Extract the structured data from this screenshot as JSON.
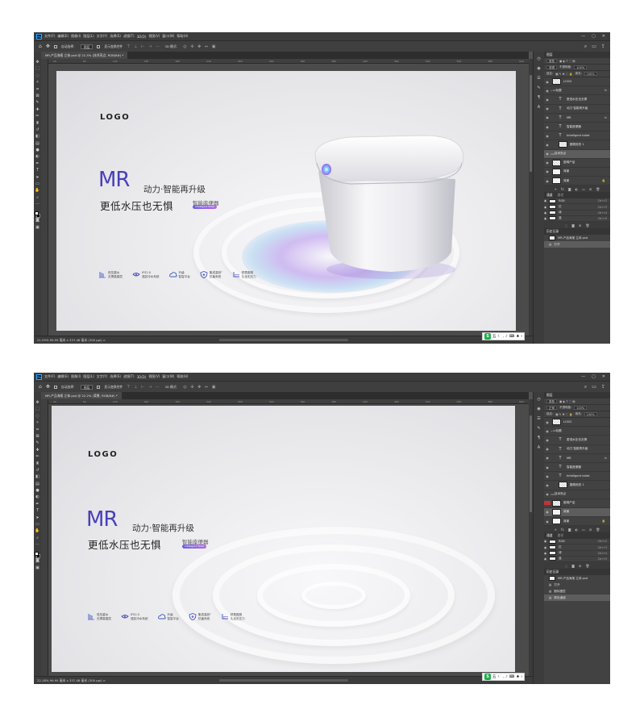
{
  "menu": {
    "items": [
      "文件(F)",
      "编辑(E)",
      "图像(I)",
      "图层(L)",
      "文字(Y)",
      "选择(S)",
      "滤镜(T)",
      "3D(D)",
      "视图(V)",
      "窗口(W)",
      "帮助(H)"
    ]
  },
  "options": {
    "auto_select": "自动选择：",
    "auto_select_value": "图层",
    "show_transform": "显示变换控件",
    "mode_3d": "3D 模式："
  },
  "top": {
    "tab_title": "MR-产品海报 立体.psd @ 21.5% (技术亮点, RGB/8#) *",
    "status": "21.55%   99.95 毫米 x 337.48 毫米 (300 ppi)   >"
  },
  "bottom": {
    "tab_title": "MR-产品海报 立体.psd @ 22.2% (背景, RGB/8#) *",
    "status": "22.18%   99.95 毫米 x 337.48 毫米 (300 ppi)   >"
  },
  "ruler": {
    "ticks": [
      "20",
      "40",
      "60",
      "80",
      "100",
      "120",
      "140",
      "160",
      "180",
      "200",
      "220",
      "240",
      "260",
      "280",
      "300",
      "320",
      "340",
      "360",
      "380",
      "400",
      "420",
      "440",
      "460",
      "480",
      "500",
      "520",
      "540",
      "560",
      "580",
      "600",
      "620"
    ]
  },
  "ime": {
    "label": "五"
  },
  "poster": {
    "logo": "LOGO",
    "mr": "MR",
    "subtitle": "动力·智能再升级",
    "tagline": "更低水压也无惧",
    "product": "智能座便器",
    "pill": "Intelligent Toilet",
    "features": [
      {
        "icon": "low-pressure-icon",
        "line1": "低压重水",
        "line2": "无惧高楼层"
      },
      {
        "icon": "flush-system-icon",
        "line1": "IFS2.0",
        "line2": "强劲冲水系统"
      },
      {
        "icon": "cloud-platform-icon",
        "line1": "升级",
        "line2": "智智平台"
      },
      {
        "icon": "antibacterial-shield-icon",
        "line1": "集成高效²",
        "line2": "抗菌系统"
      },
      {
        "icon": "seat-icon",
        "line1": "舒柔座圈",
        "line2": "久坐无压力"
      }
    ]
  },
  "panels": {
    "layers_tab": "图层",
    "kind_label": "类型",
    "blend_top": "穿透",
    "blend_bottom": "正常",
    "opacity_label": "不透明度:",
    "opacity_value": "100%",
    "lock_label": "锁定:",
    "fill_label": "填充:",
    "fill_value": "100%",
    "channels_tab": "通道",
    "paths_tab": "路径",
    "channels": [
      {
        "name": "RGB",
        "shortcut": "Ctrl+2"
      },
      {
        "name": "红",
        "shortcut": "Ctrl+3"
      },
      {
        "name": "绿",
        "shortcut": "Ctrl+4"
      },
      {
        "name": "蓝",
        "shortcut": "Ctrl+5"
      }
    ],
    "history_tab": "历史记录",
    "fx": "fx"
  },
  "layers_top": {
    "logo": "LOGO",
    "group_title": "标题",
    "t1": "更低水压也无惧",
    "t2": "动力·智能再升级",
    "t3": "MR",
    "t4": "智能座便器",
    "t5": "Intelligent toilet",
    "shape": "圆角矩形 1",
    "group_tech": "技术亮点",
    "product_layer": "座椅产品",
    "bg": "背景"
  },
  "layers_bottom": {
    "logo": "LOGO",
    "group_title": "标题",
    "t1": "更低水压也无惧",
    "t2": "动力·智能再升级",
    "t3": "MR",
    "t4": "智能座便器",
    "t5": "Intelligent toilet",
    "shape": "圆角矩形 1",
    "group_tech": "技术亮点",
    "product_layer": "座椅产品",
    "bg": "背景"
  },
  "history_top": {
    "doc": "MR-产品海报 立体.psd",
    "items": [
      "打开"
    ]
  },
  "history_bottom": {
    "doc": "MR-产品海报 立体.psd",
    "items": [
      "打开",
      "删除图层",
      "颜色通道"
    ]
  }
}
